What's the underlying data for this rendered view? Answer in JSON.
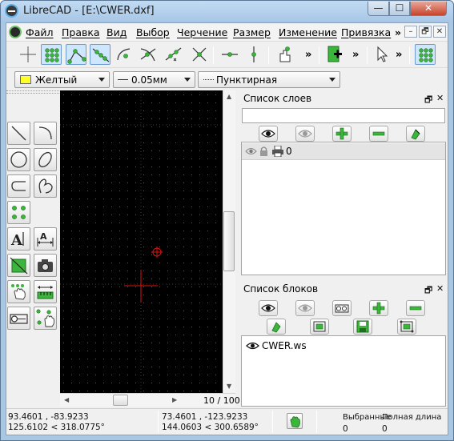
{
  "window": {
    "title": "LibreCAD - [E:\\CWER.dxf]",
    "min": "—",
    "max": "☐",
    "close": "✕"
  },
  "menu": {
    "items": [
      "Файл",
      "Правка",
      "Вид",
      "Выбор",
      "Черчение",
      "Размер",
      "Изменение",
      "Привязка"
    ],
    "more": "»",
    "mdi_min": "–",
    "mdi_restore": "🗗",
    "mdi_close": "✕"
  },
  "toolbar": {
    "more_glyph": "»"
  },
  "properties": {
    "color_label": "Желтый",
    "color_hex": "#ffff2a",
    "linewidth_label": "0.05мм",
    "linetype_label": "Пунктирная"
  },
  "canvas": {
    "page_indicator": "10 / 100"
  },
  "layers": {
    "title": "Список слоев",
    "search_value": "",
    "items": [
      {
        "name": "0"
      }
    ]
  },
  "blocks": {
    "title": "Список блоков",
    "items": [
      {
        "name": "CWER.ws"
      }
    ]
  },
  "status": {
    "abs_coord": "93.4601 , -83.9233",
    "abs_polar": "125.6102 < 318.0775°",
    "rel_coord": "73.4601 , -123.9233",
    "rel_polar": "144.0603 < 300.6589°",
    "selected_label": "Выбранные",
    "selected_value": "0",
    "length_label": "Полная длина",
    "length_value": "0"
  },
  "colors": {
    "accent_green": "#3bb53b",
    "crosshair_red": "#e01010",
    "canvas_bg": "#000000"
  }
}
